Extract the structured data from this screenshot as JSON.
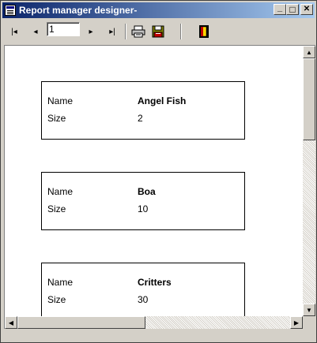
{
  "window": {
    "title": "Report manager designer-",
    "icon": "app-report-icon"
  },
  "title_buttons": {
    "minimize": "_",
    "maximize": "□",
    "close": "✕"
  },
  "toolbar": {
    "first": "|◂",
    "prev": "◂",
    "page_value": "1",
    "next": "▸",
    "last": "▸|"
  },
  "records": [
    {
      "name_label": "Name",
      "name_value": "Angel Fish",
      "size_label": "Size",
      "size_value": "2"
    },
    {
      "name_label": "Name",
      "name_value": "Boa",
      "size_label": "Size",
      "size_value": "10"
    },
    {
      "name_label": "Name",
      "name_value": "Critters",
      "size_label": "Size",
      "size_value": "30"
    }
  ],
  "scrollbars": {
    "up": "▲",
    "down": "▼",
    "left": "◀",
    "right": "▶",
    "vertical_position": 0,
    "horizontal_position": 0
  },
  "colors": {
    "title_start": "#0a246a",
    "title_end": "#a6caf0",
    "chrome": "#d4d0c8"
  }
}
